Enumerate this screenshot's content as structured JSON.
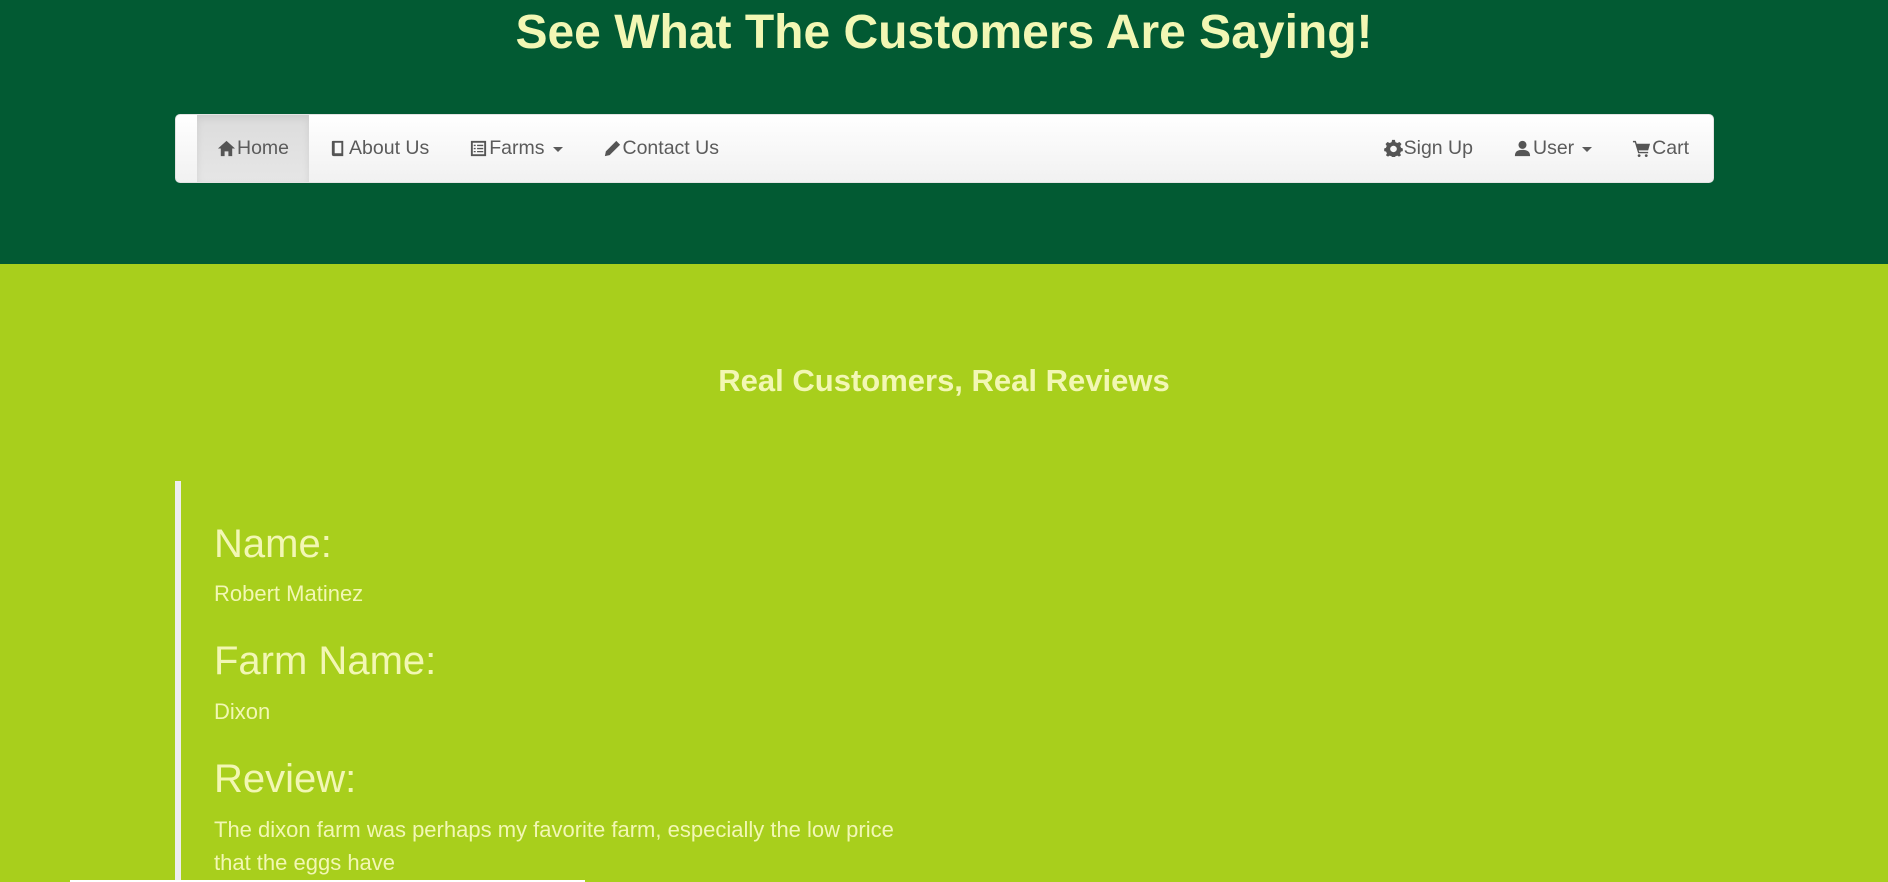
{
  "header": {
    "title": "See What The Customers Are Saying!"
  },
  "nav": {
    "left": [
      {
        "label": "Home",
        "icon": "home-icon"
      },
      {
        "label": "About Us",
        "icon": "book-icon"
      },
      {
        "label": "Farms",
        "icon": "list-icon"
      },
      {
        "label": "Contact Us",
        "icon": "pencil-icon"
      }
    ],
    "right": [
      {
        "label": "Sign Up",
        "icon": "gear-icon"
      },
      {
        "label": "User",
        "icon": "user-icon"
      },
      {
        "label": "Cart",
        "icon": "cart-icon"
      }
    ]
  },
  "section": {
    "heading": "Real Customers, Real Reviews"
  },
  "review": {
    "name_label": "Name:",
    "name": "Robert Matinez",
    "farm_label": "Farm Name:",
    "farm": "Dixon",
    "review_label": "Review:",
    "text": "The dixon farm was perhaps my favorite farm, especially the low price that the eggs have"
  },
  "colors": {
    "header_bg": "#025a33",
    "page_bg": "#a8cf1c",
    "text_light": "#f2f7b4"
  }
}
